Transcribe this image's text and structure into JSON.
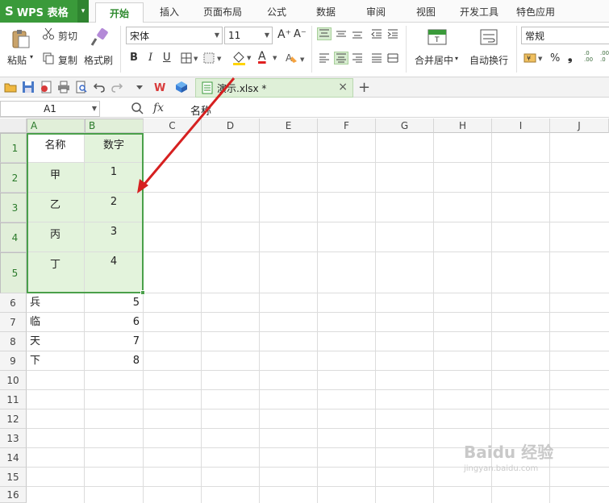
{
  "app": {
    "logo": "S",
    "name": "WPS 表格",
    "drop": "▾"
  },
  "menu": [
    "开始",
    "插入",
    "页面布局",
    "公式",
    "数据",
    "审阅",
    "视图",
    "开发工具",
    "特色应用"
  ],
  "ribbon": {
    "paste": "粘贴",
    "paste_drop": "▾",
    "cut": "剪切",
    "copy": "复制",
    "format_painter": "格式刷",
    "font": "宋体",
    "size": "11",
    "bold": "B",
    "italic": "I",
    "underline": "U",
    "font_color_glyph": "A",
    "merge": "合并居中",
    "merge_drop": "▾",
    "wrap": "自动换行",
    "number_format": "常规",
    "percent": "%",
    "comma": "❟",
    "grow_font": "A⁺",
    "shrink_font": "A⁻",
    "dec_inc": ".0\n.00",
    "dec_dec": ".00\n.0"
  },
  "quick": {
    "filename": "演示.xlsx *",
    "close": "×",
    "add": "+"
  },
  "formula": {
    "namebox": "A1",
    "fx": "fx",
    "content": "名称"
  },
  "columns": [
    "A",
    "B",
    "C",
    "D",
    "E",
    "F",
    "G",
    "H",
    "I",
    "J"
  ],
  "rows": [
    "1",
    "2",
    "3",
    "4",
    "5",
    "6",
    "7",
    "8",
    "9",
    "10",
    "11",
    "12",
    "13",
    "14",
    "15",
    "16"
  ],
  "cells": {
    "a1": "名称",
    "b1": "数字",
    "a2": "甲",
    "b2": "1",
    "a3": "乙",
    "b3": "2",
    "a4": "丙",
    "b4": "3",
    "a5": "丁",
    "b5": "4",
    "a6": "兵",
    "b6": "5",
    "a7": "临",
    "b7": "6",
    "a8": "天",
    "b8": "7",
    "a9": "下",
    "b9": "8"
  },
  "watermark": {
    "main": "Baidu 经验",
    "sub": "jingyan.baidu.com"
  },
  "colors": {
    "accent": "#3a9a3a",
    "selection": "#e3f3dc",
    "annotation": "#d62020"
  }
}
